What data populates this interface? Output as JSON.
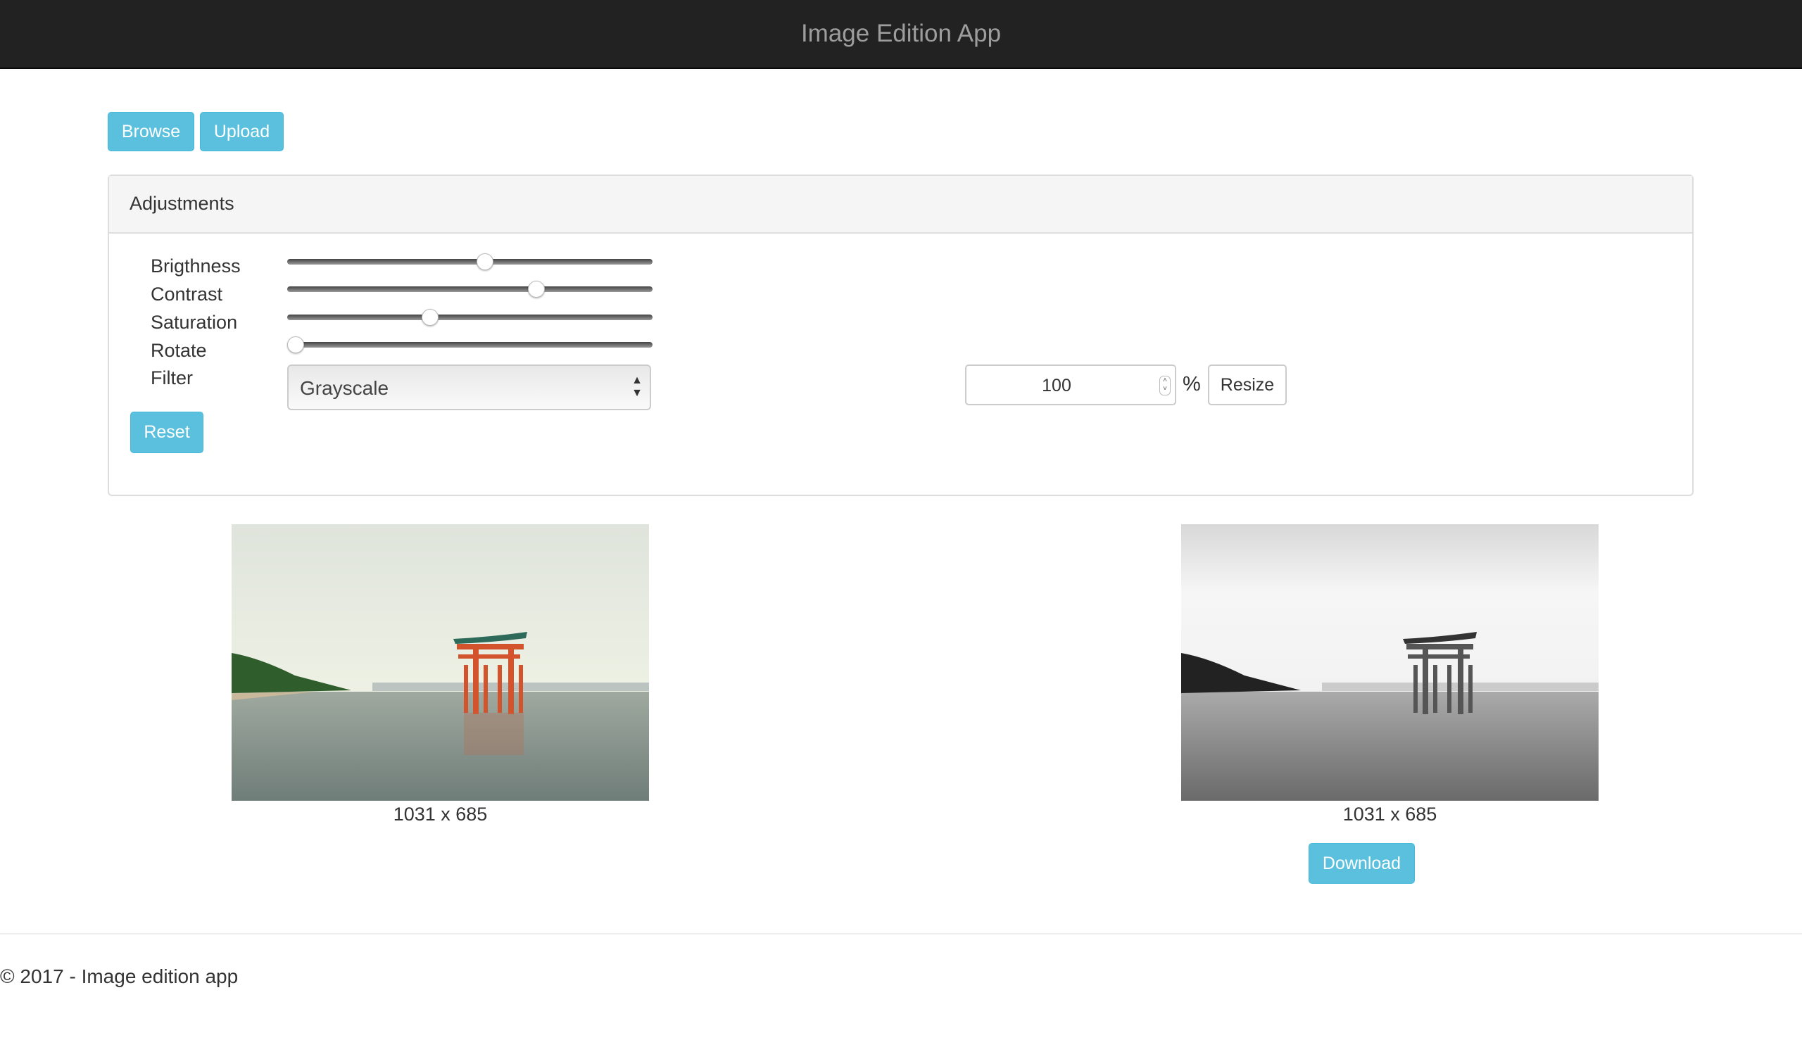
{
  "app": {
    "title": "Image Edition App"
  },
  "toolbar": {
    "browse_label": "Browse",
    "upload_label": "Upload"
  },
  "adjustments": {
    "title": "Adjustments",
    "sliders": [
      {
        "label": "Brigthness",
        "value_fraction": 0.54
      },
      {
        "label": "Contrast",
        "value_fraction": 0.68
      },
      {
        "label": "Saturation",
        "value_fraction": 0.39
      },
      {
        "label": "Rotate",
        "value_fraction": 0.0
      }
    ],
    "filter": {
      "label": "Filter",
      "selected": "Grayscale"
    },
    "reset_label": "Reset",
    "resize": {
      "value": "100",
      "unit": "%",
      "button_label": "Resize"
    }
  },
  "images": {
    "original": {
      "caption": "1031 x 685",
      "icon": "torii-gate-photo"
    },
    "edited": {
      "caption": "1031 x 685",
      "icon": "torii-gate-photo-grayscale",
      "download_label": "Download"
    }
  },
  "footer": {
    "text": "© 2017 - Image edition app"
  },
  "colors": {
    "accent": "#5bc0de",
    "navbar": "#222222"
  }
}
